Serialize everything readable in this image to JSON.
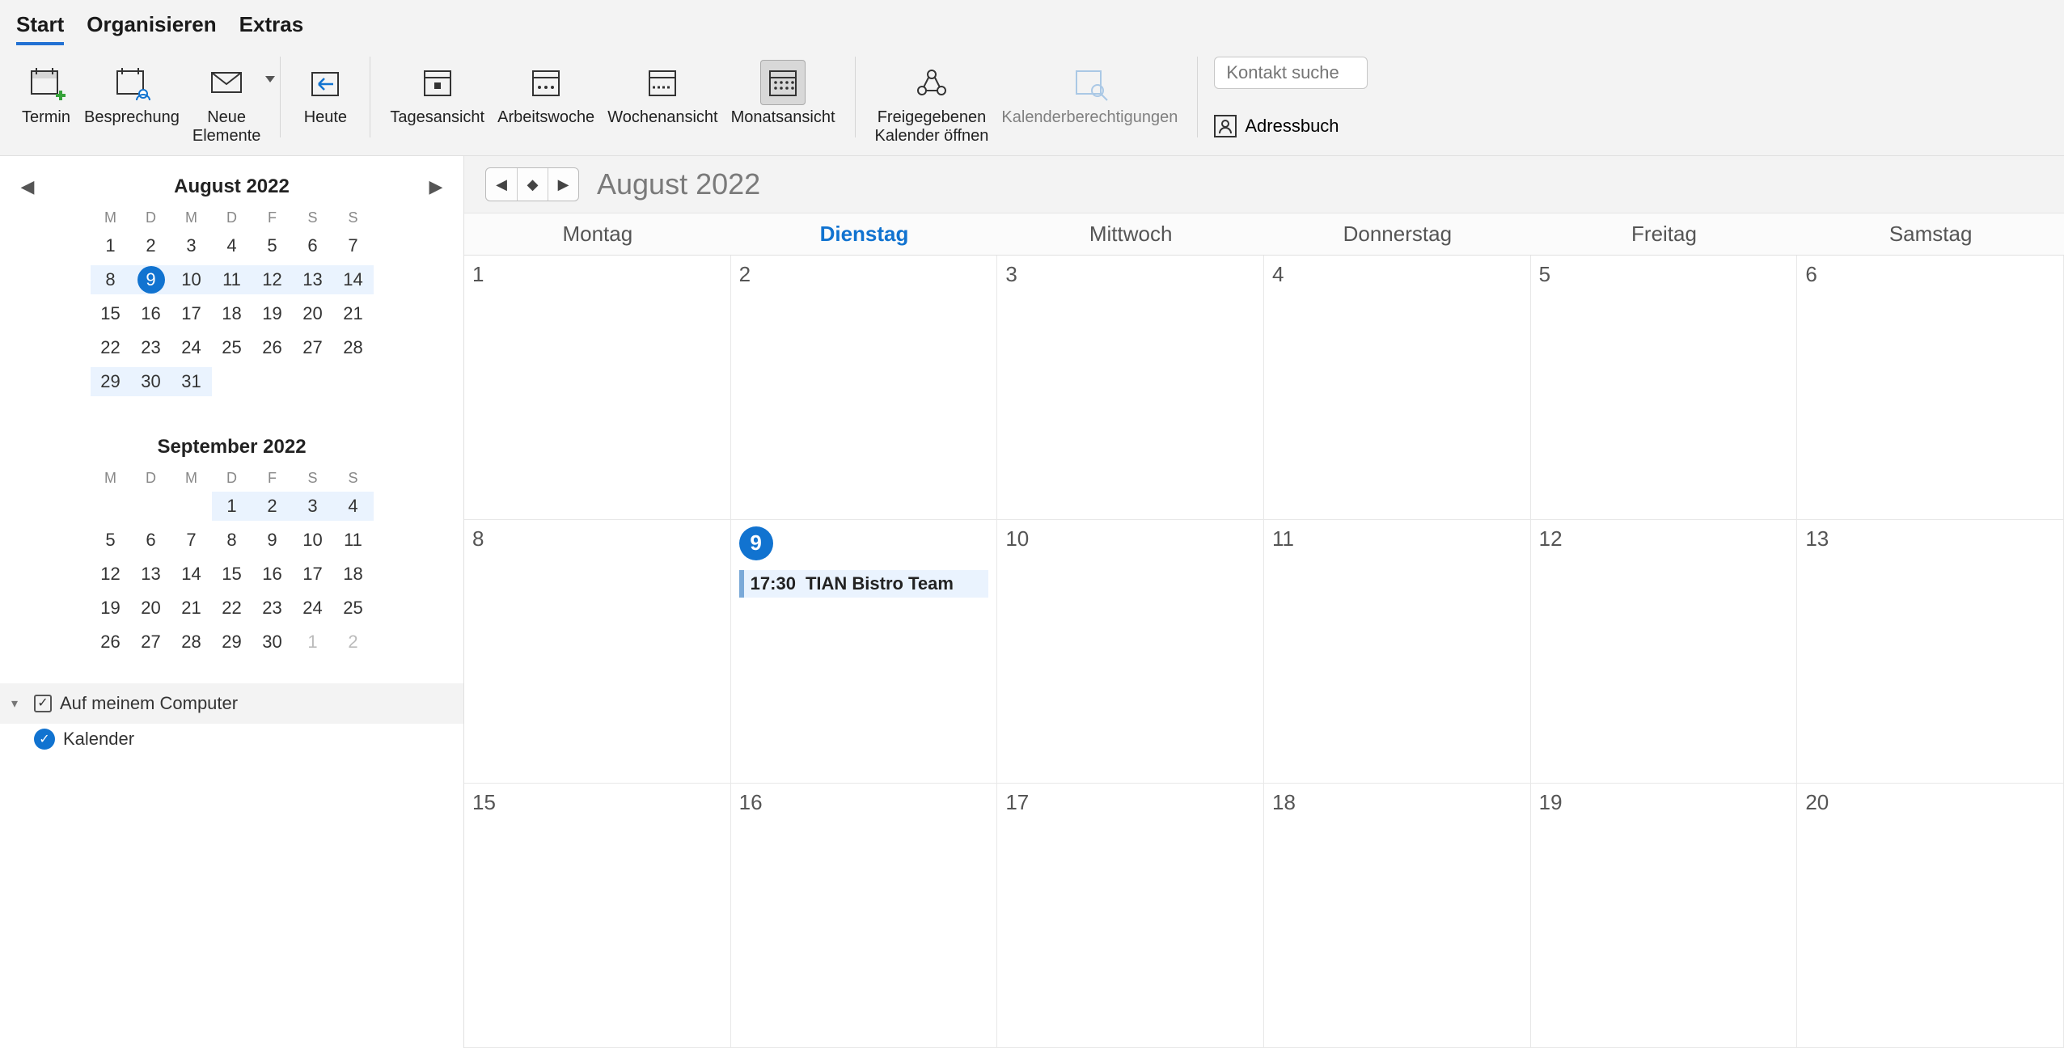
{
  "tabs": {
    "start": "Start",
    "org": "Organisieren",
    "extras": "Extras"
  },
  "ribbon": {
    "termin": "Termin",
    "besprechung": "Besprechung",
    "neue": "Neue\nElemente",
    "heute": "Heute",
    "tagesansicht": "Tagesansicht",
    "arbeitswoche": "Arbeitswoche",
    "wochenansicht": "Wochenansicht",
    "monatsansicht": "Monatsansicht",
    "freigegeben": "Freigegebenen\nKalender öffnen",
    "berechtigungen": "Kalenderberechtigungen",
    "search_placeholder": "Kontakt suche",
    "adressbuch": "Adressbuch"
  },
  "mini": {
    "dow": [
      "M",
      "D",
      "M",
      "D",
      "F",
      "S",
      "S"
    ],
    "m1": {
      "title": "August 2022",
      "leading_blanks": 0,
      "days": 31,
      "today": 9,
      "hl_row": 2,
      "band_last": 3
    },
    "m2": {
      "title": "September 2022",
      "leading_blanks": 3,
      "days": 30,
      "today": 0,
      "band_first": 4,
      "trailing_dim": [
        1,
        2
      ]
    }
  },
  "tree": {
    "root": "Auf meinem Computer",
    "cal": "Kalender"
  },
  "cal": {
    "title": "August 2022",
    "dow": [
      "Montag",
      "Dienstag",
      "Mittwoch",
      "Donnerstag",
      "Freitag",
      "Samstag"
    ],
    "today_idx": 1,
    "weeks": [
      [
        {
          "n": 1
        },
        {
          "n": 2
        },
        {
          "n": 3
        },
        {
          "n": 4
        },
        {
          "n": 5
        },
        {
          "n": 6
        }
      ],
      [
        {
          "n": 8
        },
        {
          "n": 9,
          "today": true,
          "event": {
            "time": "17:30",
            "title": "TIAN Bistro Team"
          }
        },
        {
          "n": 10
        },
        {
          "n": 11
        },
        {
          "n": 12
        },
        {
          "n": 13
        }
      ],
      [
        {
          "n": 15
        },
        {
          "n": 16
        },
        {
          "n": 17
        },
        {
          "n": 18
        },
        {
          "n": 19
        },
        {
          "n": 20
        }
      ]
    ]
  }
}
